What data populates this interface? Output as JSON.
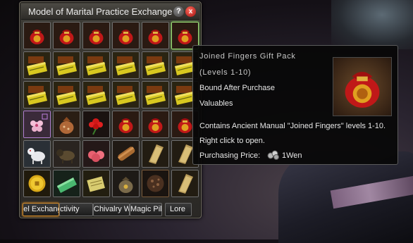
{
  "window": {
    "title": "Model of Marital Practice Exchange",
    "help_label": "?",
    "close_label": "x"
  },
  "grid_items": [
    {
      "icon": "gift-pack-icon",
      "kind": "bag",
      "selected": false
    },
    {
      "icon": "gift-pack-icon",
      "kind": "bag",
      "selected": false
    },
    {
      "icon": "gift-pack-icon",
      "kind": "bag",
      "selected": false
    },
    {
      "icon": "gift-pack-icon",
      "kind": "bag",
      "selected": false
    },
    {
      "icon": "gift-pack-icon",
      "kind": "bag",
      "selected": false
    },
    {
      "icon": "gift-pack-icon",
      "kind": "bag",
      "selected": true
    },
    {
      "icon": "manual-book-icon",
      "kind": "book",
      "selected": false
    },
    {
      "icon": "manual-book-icon",
      "kind": "book",
      "selected": false
    },
    {
      "icon": "manual-book-icon",
      "kind": "book",
      "selected": false
    },
    {
      "icon": "manual-book-icon",
      "kind": "book",
      "selected": false
    },
    {
      "icon": "manual-book-icon",
      "kind": "book",
      "selected": false
    },
    {
      "icon": "manual-book-icon",
      "kind": "book",
      "selected": false
    },
    {
      "icon": "manual-book-icon",
      "kind": "book",
      "selected": false
    },
    {
      "icon": "manual-book-icon",
      "kind": "book",
      "selected": false
    },
    {
      "icon": "manual-book-icon",
      "kind": "book",
      "selected": false
    },
    {
      "icon": "manual-book-icon",
      "kind": "book",
      "selected": false
    },
    {
      "icon": "manual-book-icon",
      "kind": "book",
      "selected": false
    },
    {
      "icon": "manual-book-icon",
      "kind": "book",
      "selected": false
    },
    {
      "icon": "blossom-icon",
      "kind": "blossom",
      "selected": false
    },
    {
      "icon": "pouch-icon",
      "kind": "pouch",
      "selected": false
    },
    {
      "icon": "red-flower-icon",
      "kind": "flower",
      "selected": false
    },
    {
      "icon": "gift-pack-icon",
      "kind": "bag",
      "selected": false
    },
    {
      "icon": "gift-pack-icon",
      "kind": "bag",
      "selected": false
    },
    {
      "icon": "gift-pack-icon",
      "kind": "bag",
      "selected": false
    },
    {
      "icon": "white-pet-icon",
      "kind": "pet-white",
      "selected": false
    },
    {
      "icon": "dark-pet-icon",
      "kind": "pet-dark",
      "selected": false
    },
    {
      "icon": "peaches-icon",
      "kind": "peaches",
      "selected": false
    },
    {
      "icon": "scroll-icon",
      "kind": "scroll",
      "selected": false
    },
    {
      "icon": "tablet-icon",
      "kind": "tablet",
      "selected": false
    },
    {
      "icon": "tablet-icon",
      "kind": "tablet",
      "selected": false
    },
    {
      "icon": "gold-coin-icon",
      "kind": "coin",
      "selected": false
    },
    {
      "icon": "green-book-icon",
      "kind": "green-book",
      "selected": false
    },
    {
      "icon": "yellow-letter-icon",
      "kind": "letter",
      "selected": false
    },
    {
      "icon": "treasure-pouch-icon",
      "kind": "treasure-pouch",
      "selected": false
    },
    {
      "icon": "dark-stone-icon",
      "kind": "stone",
      "selected": false
    },
    {
      "icon": "tablet-icon",
      "kind": "tablet",
      "selected": false
    }
  ],
  "tabs": [
    {
      "label": "odel Exchange",
      "active": true
    },
    {
      "label": "ctivity",
      "active": false
    },
    {
      "label": "Chivalry Welc",
      "active": false
    },
    {
      "label": "Magic Pill",
      "active": false
    },
    {
      "label": "Lore",
      "active": false
    }
  ],
  "tooltip": {
    "name": "Joined Fingers Gift Pack",
    "level": "(Levels 1-10)",
    "binding": "Bound After Purchase",
    "category": "Valuables",
    "description_line1": "Contains Ancient Manual \"Joined Fingers\" levels 1-10.",
    "description_line2": "Right click to open.",
    "price_label": "Purchasing Price:",
    "price_value": "1Wen",
    "icon": "gift-pack-icon",
    "price_icon": "coins-icon"
  }
}
